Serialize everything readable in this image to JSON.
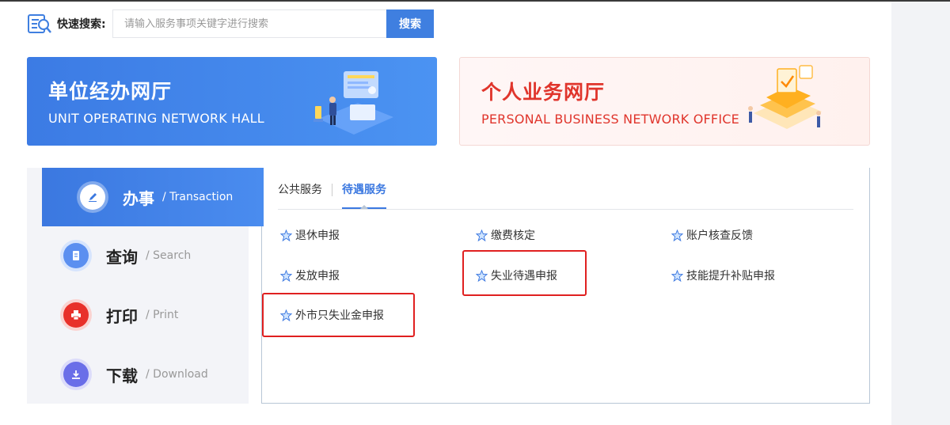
{
  "search": {
    "label": "快速搜索:",
    "placeholder": "请输入服务事项关键字进行搜索",
    "value": "",
    "button_label": "搜索"
  },
  "banners": {
    "unit": {
      "title": "单位经办网厅",
      "subtitle": "UNIT OPERATING NETWORK HALL",
      "illustration": "office-desk-illustration"
    },
    "personal": {
      "title": "个人业务网厅",
      "subtitle": "PERSONAL BUSINESS NETWORK OFFICE",
      "illustration": "personal-business-illustration"
    }
  },
  "side_nav": {
    "items": [
      {
        "label": "办事",
        "sub": "/ Transaction",
        "icon": "pen-icon",
        "active": true
      },
      {
        "label": "查询",
        "sub": "/ Search",
        "icon": "document-icon",
        "active": false
      },
      {
        "label": "打印",
        "sub": "/ Print",
        "icon": "printer-icon",
        "active": false
      },
      {
        "label": "下载",
        "sub": "/ Download",
        "icon": "download-icon",
        "active": false
      }
    ]
  },
  "tabs": [
    {
      "label": "公共服务",
      "active": false
    },
    {
      "label": "待遇服务",
      "active": true
    }
  ],
  "services": [
    {
      "label": "退休申报",
      "icon": "star-icon"
    },
    {
      "label": "缴费核定",
      "icon": "star-icon"
    },
    {
      "label": "账户核查反馈",
      "icon": "star-icon"
    },
    {
      "label": "发放申报",
      "icon": "star-icon"
    },
    {
      "label": "失业待遇申报",
      "icon": "star-icon",
      "highlighted": true
    },
    {
      "label": "技能提升补贴申报",
      "icon": "star-icon"
    },
    {
      "label": "外市只失业金申报",
      "icon": "star-icon",
      "highlighted": true
    }
  ],
  "colors": {
    "accent_blue": "#3b78e0",
    "personal_red": "#e0352c",
    "highlight_red": "#e02020"
  }
}
